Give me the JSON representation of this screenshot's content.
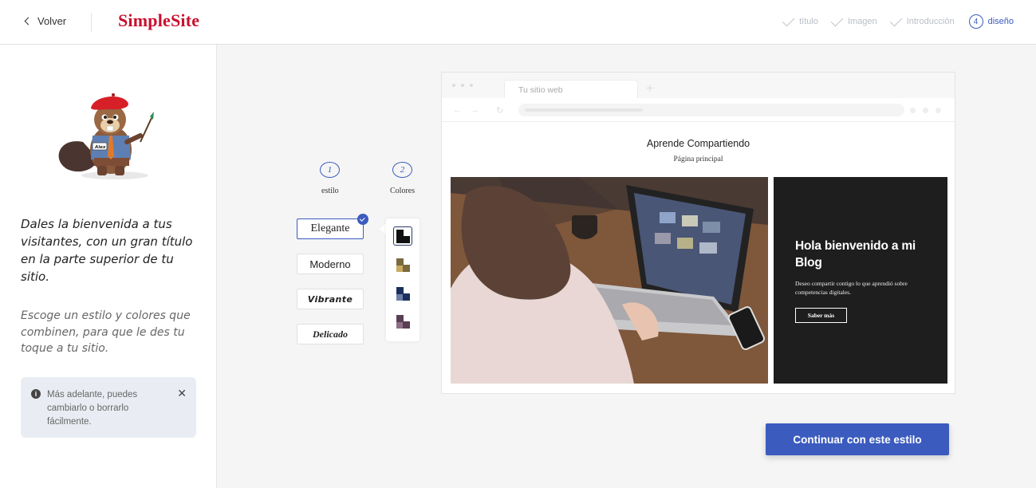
{
  "header": {
    "back_label": "Volver",
    "logo": "SimpleSite",
    "steps": [
      {
        "label": "título",
        "state": "done"
      },
      {
        "label": "Imagen",
        "state": "done"
      },
      {
        "label": "Introducción",
        "state": "done"
      },
      {
        "number": "4",
        "label": "diseño",
        "state": "active"
      }
    ]
  },
  "sidebar": {
    "headline": "Dales la bienvenida a tus visitantes, con un gran título en la parte superior de tu sitio.",
    "subtext": "Escoge un estilo y colores que combinen, para que le des tu toque a tu sitio.",
    "info": {
      "text": "Más adelante, puedes cambiarlo o borrarlo fácilmente.",
      "icon": "info-icon",
      "close_icon": "close-icon"
    },
    "mascot_name_tag": "Alex"
  },
  "selectors": {
    "style_step": {
      "number": "1",
      "label": "estilo"
    },
    "color_step": {
      "number": "2",
      "label": "Colores"
    },
    "styles": [
      {
        "label": "Elegante",
        "selected": true
      },
      {
        "label": "Moderno",
        "selected": false
      },
      {
        "label": "Vibrante",
        "selected": false
      },
      {
        "label": "Delicado",
        "selected": false
      }
    ],
    "palettes": [
      {
        "primary": "#111111",
        "secondary": "#111111",
        "selected": true
      },
      {
        "primary": "#7a6a3e",
        "secondary": "#c9ab62",
        "selected": false
      },
      {
        "primary": "#1b2f5e",
        "secondary": "#6c7fa6",
        "selected": false
      },
      {
        "primary": "#5a3f52",
        "secondary": "#8e6e86",
        "selected": false
      }
    ]
  },
  "preview": {
    "tab_title": "Tu sitio web",
    "site_title": "Aprende Compartiendo",
    "site_subtitle": "Página principal",
    "hero_heading": "Hola bienvenido a mi Blog",
    "hero_text": "Deseo compartir contigo lo que aprendió sobre competencias digitales.",
    "hero_button": "Saber más"
  },
  "cta_label": "Continuar con este estilo",
  "colors": {
    "accent": "#3b5bbf",
    "logo": "#c8102e",
    "hero_dark": "#1e1e1e"
  }
}
